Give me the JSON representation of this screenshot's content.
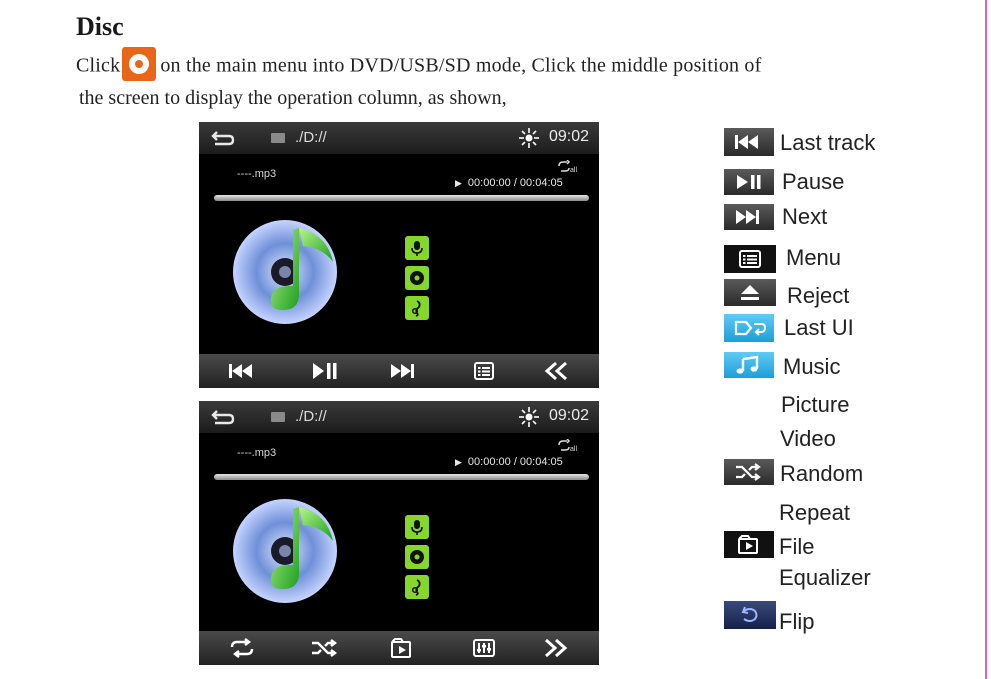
{
  "heading": "Disc",
  "intro": {
    "part1": "Click",
    "part2": "on the main menu into DVD/USB/SD mode, Click the middle position of",
    "line2": "the screen to display the operation column, as shown,"
  },
  "screens": [
    {
      "path": "./D://",
      "clock": "09:02",
      "file_name": "----.mp3",
      "time_current": "00:00:00",
      "time_total": "/ 00:04:05",
      "repeat_badge": "all",
      "bottom_buttons": [
        "prev-track",
        "play-pause",
        "next-track",
        "menu",
        "collapse"
      ]
    },
    {
      "path": "./D://",
      "clock": "09:02",
      "file_name": "----.mp3",
      "time_current": "00:00:00",
      "time_total": "/ 00:04:05",
      "repeat_badge": "all",
      "bottom_buttons": [
        "repeat",
        "random",
        "file",
        "equalizer",
        "expand"
      ]
    }
  ],
  "legend": [
    {
      "icon": "prev-track-icon",
      "label": "Last track"
    },
    {
      "icon": "play-pause-icon",
      "label": "Pause"
    },
    {
      "icon": "next-track-icon",
      "label": "Next"
    },
    {
      "icon": "menu-icon",
      "label": "Menu"
    },
    {
      "icon": "eject-icon",
      "label": "Reject"
    },
    {
      "icon": "return-icon",
      "label": "Last UI"
    },
    {
      "icon": "music-icon",
      "label": "Music"
    },
    {
      "icon": "",
      "label": "Picture"
    },
    {
      "icon": "",
      "label": "Video"
    },
    {
      "icon": "shuffle-icon",
      "label": "Random"
    },
    {
      "icon": "",
      "label": "Repeat"
    },
    {
      "icon": "file-icon",
      "label": "File"
    },
    {
      "icon": "",
      "label": "Equalizer"
    },
    {
      "icon": "flip-icon",
      "label": "Flip"
    }
  ],
  "colors": {
    "accent_orange": "#e8661a",
    "side_icon_green": "#86d62c",
    "page_border": "#e060c8"
  }
}
